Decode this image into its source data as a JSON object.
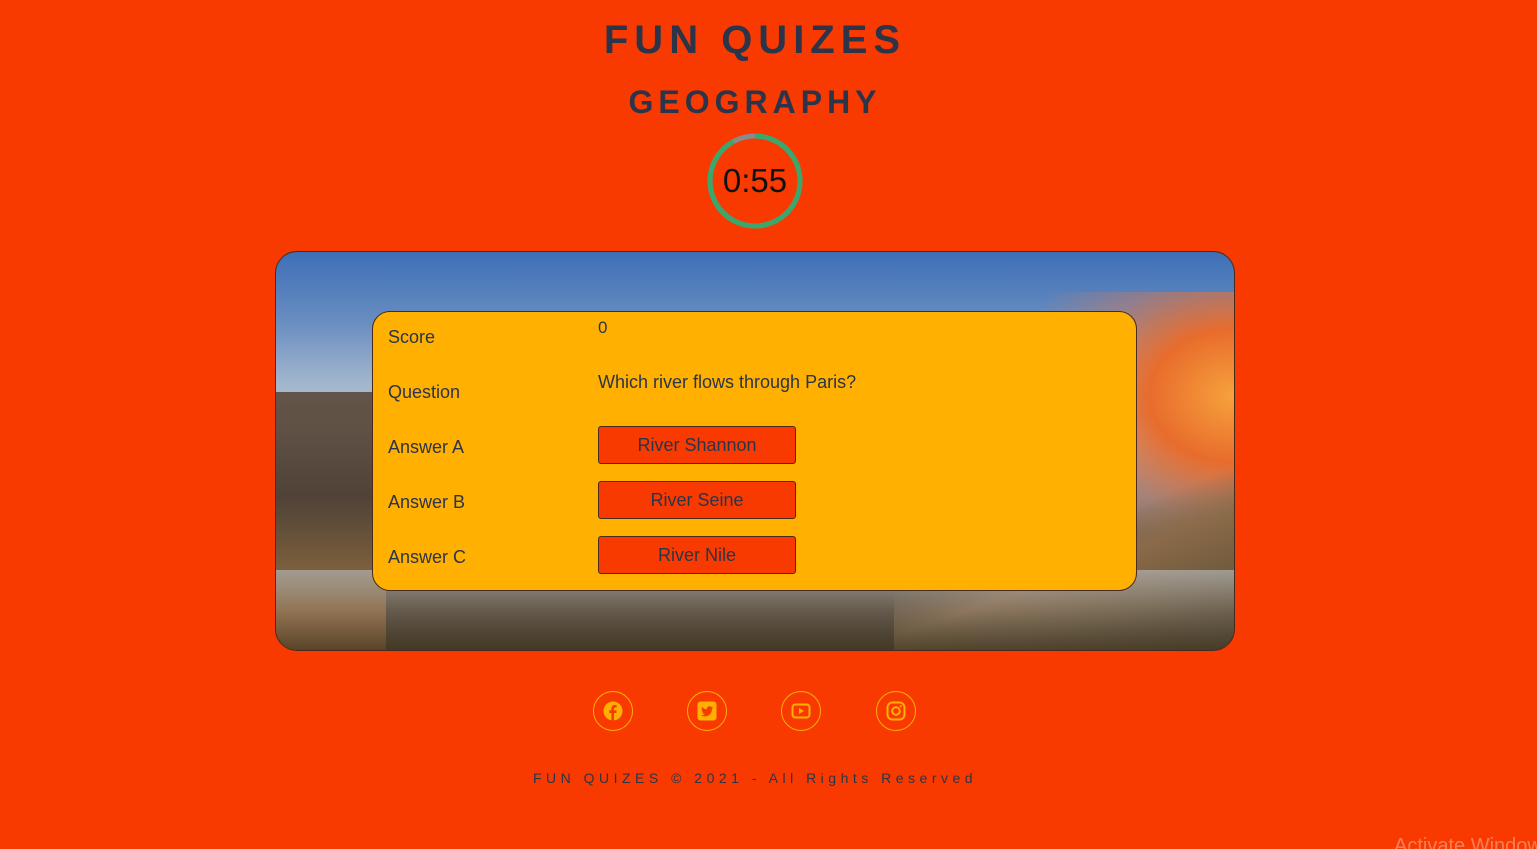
{
  "header": {
    "site_title": "FUN QUIZES",
    "category": "GEOGRAPHY"
  },
  "timer": {
    "label": "0:55",
    "remaining_fraction": 0.92,
    "ring_color": "#3aa76d",
    "track_color": "#8a8a8a"
  },
  "quiz": {
    "score_label": "Score",
    "score_value": "0",
    "question_label": "Question",
    "question_text": "Which river flows through Paris?",
    "answers": [
      {
        "label": "Answer A",
        "text": "River Shannon"
      },
      {
        "label": "Answer B",
        "text": "River Seine"
      },
      {
        "label": "Answer C",
        "text": "River Nile"
      }
    ]
  },
  "socials": [
    {
      "icon": "facebook-icon"
    },
    {
      "icon": "twitter-icon"
    },
    {
      "icon": "youtube-icon"
    },
    {
      "icon": "instagram-icon"
    }
  ],
  "footer": {
    "copyright": "FUN QUIZES © 2021 - All Rights Reserved"
  },
  "watermark": {
    "text": "Activate Windows"
  },
  "colors": {
    "background": "#f83a00",
    "card": "#ffb000",
    "text": "#2b3448",
    "icon": "#ffb000"
  }
}
